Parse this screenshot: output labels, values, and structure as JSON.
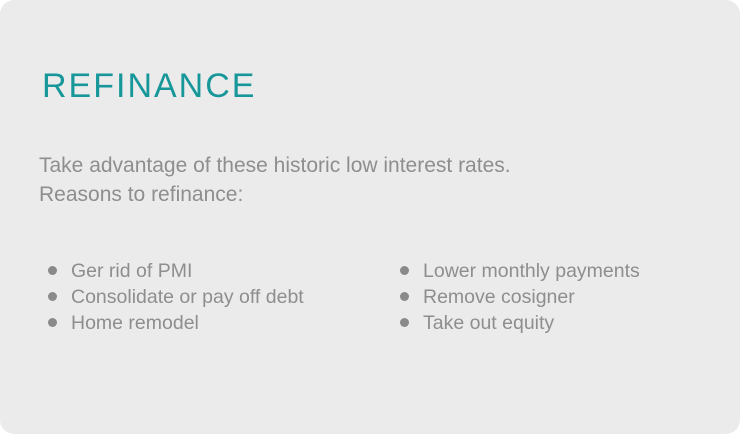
{
  "title": "REFINANCE",
  "intro": {
    "line1": "Take advantage of these historic low interest rates.",
    "line2": "Reasons to refinance:"
  },
  "reasons_left": [
    "Ger rid of PMI",
    "Consolidate or pay off debt",
    "Home remodel"
  ],
  "reasons_right": [
    "Lower monthly payments",
    "Remove cosigner",
    "Take out equity"
  ],
  "colors": {
    "accent": "#17979a",
    "text": "#8e8e8e",
    "background": "#ebebeb"
  },
  "icons": {
    "bullet": "bullet-dot-icon"
  }
}
